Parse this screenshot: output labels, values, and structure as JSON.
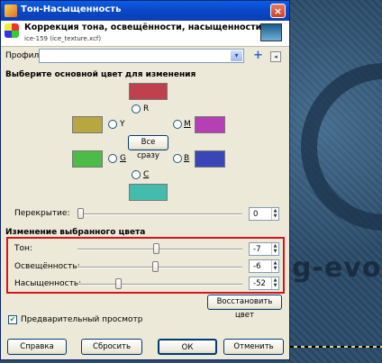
{
  "window": {
    "title": "Тон-Насыщенность",
    "close": "×"
  },
  "header": {
    "title": "Коррекция тона, освещённости, насыщенности",
    "subtitle": "ice-159 (ice_texture.xcf)"
  },
  "presets": {
    "label": "Профили:",
    "value": "",
    "arrow": "▾",
    "add": "+",
    "menu": "◂"
  },
  "primary": {
    "heading": "Выберите основной цвет для изменения",
    "swatches": {
      "R": "#c0404e",
      "Y": "#b8a640",
      "M": "#b63fb6",
      "G": "#4cbb48",
      "B": "#3a45b8",
      "C": "#43bcae"
    },
    "labels": {
      "R": "R",
      "Y": "Y",
      "M": "M",
      "G": "G",
      "B": "B",
      "C": "C"
    },
    "master_button": "Все сразу"
  },
  "overlap": {
    "label": "Перекрытие:",
    "value": "0"
  },
  "adjust": {
    "heading": "Изменение выбранного цвета",
    "hue": {
      "label": "Тон:",
      "value": "-7"
    },
    "lightness": {
      "label": "Освещённость:",
      "value": "-6"
    },
    "saturation": {
      "label": "Насыщенность:",
      "value": "-52"
    },
    "reset_color": "Восстановить цвет"
  },
  "preview": {
    "label": "Предварительный просмотр",
    "checked": true
  },
  "buttons": {
    "help": "Справка",
    "reset": "Сбросить",
    "ok": "ОК",
    "cancel": "Отменить"
  },
  "canvas": {
    "text": "g-evo"
  }
}
